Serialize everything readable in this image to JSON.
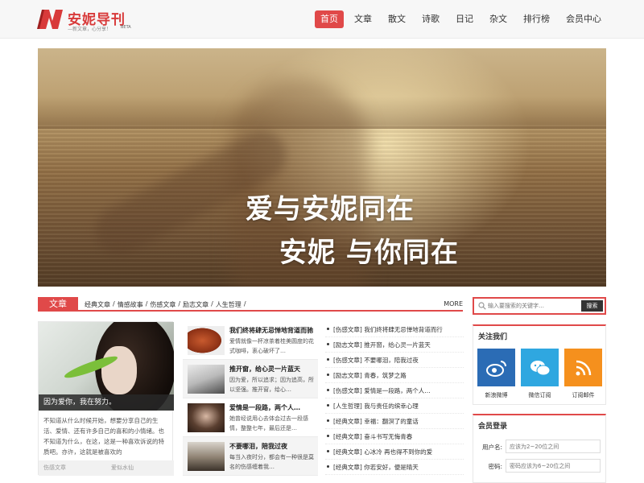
{
  "header": {
    "logo_title": "安妮导刊",
    "logo_sub": "—新文章，心分享！",
    "logo_beta": "BETA",
    "nav": [
      "首页",
      "文章",
      "散文",
      "诗歌",
      "日记",
      "杂文",
      "排行榜",
      "会员中心"
    ],
    "active_nav": "首页",
    "accent": "#e04949"
  },
  "banner": {
    "line1": "爱与安妮同在",
    "line2": "安妮 与你同在",
    "prev_icon": "chevron-left-icon",
    "next_icon": "chevron-right-icon"
  },
  "section": {
    "tab": "文章",
    "links": [
      "经典文章",
      "情感故事",
      "伤感文章",
      "励志文章",
      "人生哲理"
    ],
    "more": "MORE"
  },
  "feature": {
    "caption": "因为爱你，我在努力。",
    "text": "不知道从什么时候开始，想要分享自己的生活、爱情、还有许多自己的喜和的小情绪。也不知道为什么，在这，这是一种喜欢诉说的特质吧。亦许，这就是被喜欢的",
    "category": "伤感文章",
    "author": "爱似水仙"
  },
  "mid_list": [
    {
      "title": "我们终将肆无忌惮地背道而驰",
      "desc": "爱情就像一杯凉茶着桂美圆度的花式咖啡，衷心破坏了…"
    },
    {
      "title": "推开窗，给心灵一片蓝天",
      "desc": "因为爱，所以追求；因为追高，所以坚强。推开窗，给心…"
    },
    {
      "title": "爱情是一段路，两个人…",
      "desc": "她曾经说用心去体会过去一段感情，整整七年，最后还是…"
    },
    {
      "title": "不要哪泪，陪我过夜",
      "desc": "每当入夜时分，都会有一种很是莫名的伤感缠着我…"
    }
  ],
  "right_list": [
    "[伤感文章] 我们终将肆无忌惮地背道而行",
    "[励志文章] 推开窗，给心灵一片蓝天",
    "[伤感文章] 不要哪泪，陪我过夜",
    "[励志文章] 青春，筑梦之路",
    "[伤感文章] 爱情是一段路，两个人…",
    "[人生哲理] 我与责任的缤幸心理",
    "[经典文章] 幸福：翻溟了的童话",
    "[经典文章] 奋斗书写无悔青春",
    "[经典文章] 心冰冷 再也得不到你的爱",
    "[经典文章] 你若安好，便是晴天"
  ],
  "search": {
    "placeholder": "输入要搜索的关键字…",
    "button": "搜索"
  },
  "follow": {
    "title": "关注我们",
    "items": [
      {
        "label": "新浪微博",
        "icon": "weibo-icon",
        "color": "#2b6cb5"
      },
      {
        "label": "微信订阅",
        "icon": "wechat-icon",
        "color": "#2fa7e0"
      },
      {
        "label": "订阅邮件",
        "icon": "rss-icon",
        "color": "#f5901d"
      }
    ]
  },
  "login": {
    "title": "会员登录",
    "username_label": "用户名:",
    "username_placeholder": "应该为2~20位之间",
    "password_label": "密码:",
    "password_placeholder": "密码应该为6~20位之间"
  }
}
